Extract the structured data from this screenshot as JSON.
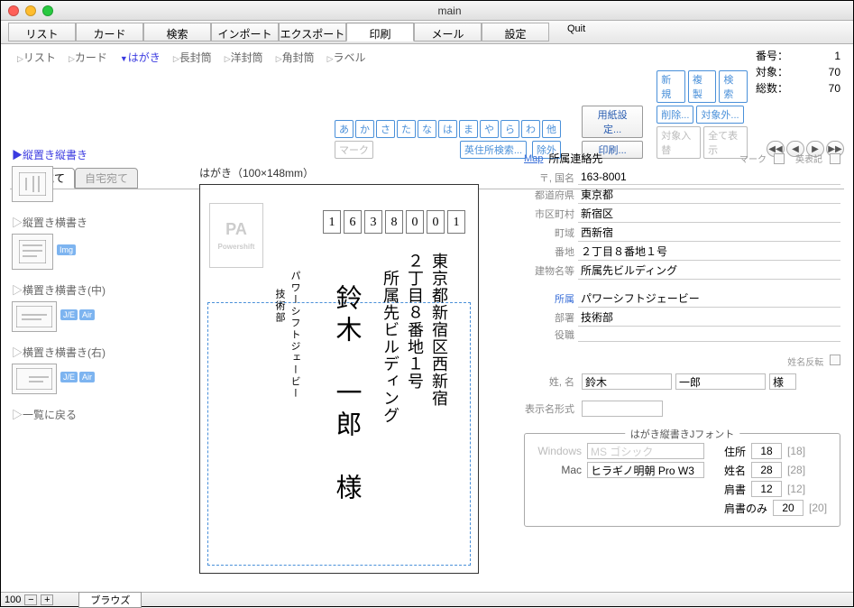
{
  "window": {
    "title": "main"
  },
  "toolbar": {
    "items": [
      "リスト",
      "カード",
      "検索",
      "インポート",
      "エクスポート",
      "印刷",
      "メール",
      "設定"
    ],
    "quit": "Quit",
    "active_index": 5
  },
  "subtabs": {
    "items": [
      "リスト",
      "カード",
      "はがき",
      "長封筒",
      "洋封筒",
      "角封筒",
      "ラベル"
    ],
    "active_index": 2
  },
  "counters": {
    "number_label": "番号：",
    "number_value": "1",
    "target_label": "対象：",
    "target_value": "70",
    "total_label": "総数：",
    "total_value": "70"
  },
  "kana_pills": [
    "あ",
    "か",
    "さ",
    "た",
    "な",
    "は",
    "ま",
    "や",
    "ら",
    "わ",
    "他"
  ],
  "mark_pill": "マーク",
  "eng_search": "英住所検索...",
  "exclude": "除外",
  "page_setup": "用紙設定...",
  "print": "印刷...",
  "ops": {
    "new": "新規",
    "dup": "複製",
    "search": "検索",
    "del": "削除...",
    "target_ex": "対象外...",
    "swap": "対象入替",
    "showall": "全て表示"
  },
  "addr_tabs": {
    "items": [
      "所属宛て",
      "自宅宛て"
    ],
    "active_index": 0
  },
  "side_options": {
    "o1": "縦置き縦書き",
    "o2": "縦置き横書き",
    "o3": "横置き横書き(中)",
    "o4": "横置き横書き(右)",
    "back": "一覧に戻る",
    "img": "Img",
    "je": "J/E",
    "air": "Air"
  },
  "preview": {
    "caption": "はがき（100×148mm）",
    "pa": "PA",
    "powershift": "Powershift",
    "zip": [
      "1",
      "6",
      "3",
      "8",
      "0",
      "0",
      "1"
    ],
    "addr1": "東京都新宿区西新宿",
    "addr2": "２丁目８番地１号",
    "addr3": "　所属先ビルディング",
    "name": "鈴木　一郎　様",
    "from1": "パワーシフトジェービー",
    "from2": "技術部"
  },
  "fields": {
    "map": "Map",
    "header": "所属連絡先",
    "mark_label": "マーク",
    "eng_label": "英表記",
    "postal_label": "〒, 国名",
    "postal": "163-8001",
    "pref_label": "都道府県",
    "pref": "東京都",
    "city_label": "市区町村",
    "city": "新宿区",
    "town_label": "町域",
    "town": "西新宿",
    "street_label": "番地",
    "street": "２丁目８番地１号",
    "bldg_label": "建物名等",
    "bldg": "所属先ビルディング",
    "aff_label": "所属",
    "aff": "パワーシフトジェービー",
    "dept_label": "部署",
    "dept": "技術部",
    "role_label": "役職",
    "role": "",
    "name_reverse": "姓名反転",
    "name_label": "姓, 名",
    "lastname": "鈴木",
    "firstname": "一郎",
    "honor": "様",
    "dispname_label": "表示名形式"
  },
  "fonts": {
    "legend": "はがき縦書きJフォント",
    "win_label": "Windows",
    "win_font": "MS ゴシック",
    "mac_label": "Mac",
    "mac_font": "ヒラギノ明朝 Pro W3",
    "addr_label": "住所",
    "addr_size": "18",
    "addr_def": "[18]",
    "name_label": "姓名",
    "name_size": "28",
    "name_def": "[28]",
    "shoulder_label": "肩書",
    "shoulder_size": "12",
    "shoulder_def": "[12]",
    "shoulder_only_label": "肩書のみ",
    "shoulder_only_size": "20",
    "shoulder_only_def": "[20]"
  },
  "status": {
    "zoom": "100",
    "browse": "ブラウズ"
  }
}
